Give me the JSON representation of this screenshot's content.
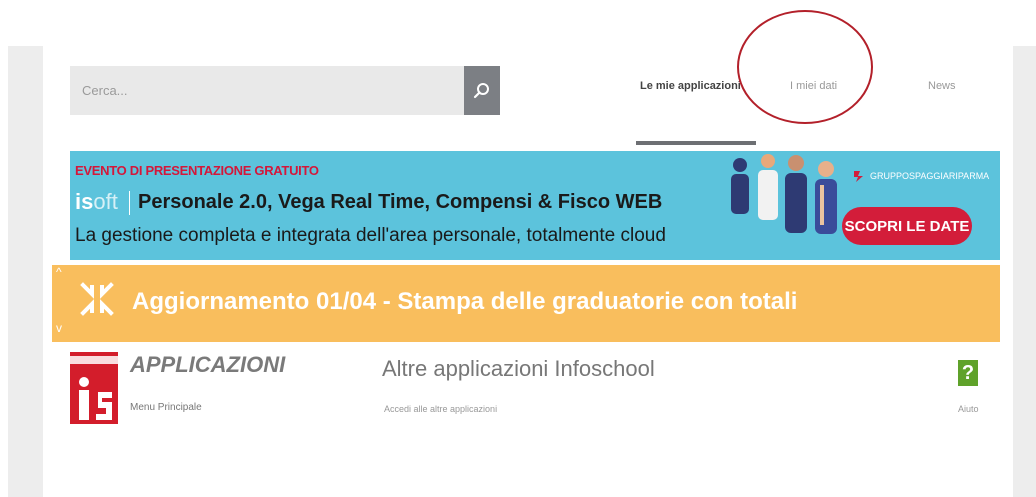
{
  "search": {
    "placeholder": "Cerca..."
  },
  "tabs": [
    {
      "label": "Le mie applicazioni",
      "active": true
    },
    {
      "label": "I miei dati",
      "active": false
    },
    {
      "label": "News",
      "active": false
    }
  ],
  "banner": {
    "event": "EVENTO DI PRESENTAZIONE GRATUITO",
    "logo_a": "is",
    "logo_b": "oft",
    "product": "Personale 2.0, Vega Real Time, Compensi & Fisco WEB",
    "description": "La gestione completa e integrata dell'area personale, totalmente cloud",
    "brand": "GRUPPOSPAGGIARIPARMA",
    "cta": "SCOPRI LE DATE"
  },
  "news": {
    "title": "Aggiornamento 01/04 - Stampa delle graduatorie con totali"
  },
  "apps": {
    "title": "APPLICAZIONI",
    "subtitle": "Menu Principale",
    "other_title": "Altre applicazioni Infoschool",
    "other_subtitle": "Accedi alle altre applicazioni",
    "help_label": "Aiuto",
    "help_glyph": "?"
  },
  "colors": {
    "banner_bg": "#5cc3dc",
    "news_bg": "#f9be5d",
    "accent_red": "#d31d3a",
    "help_green": "#5fa22a"
  }
}
